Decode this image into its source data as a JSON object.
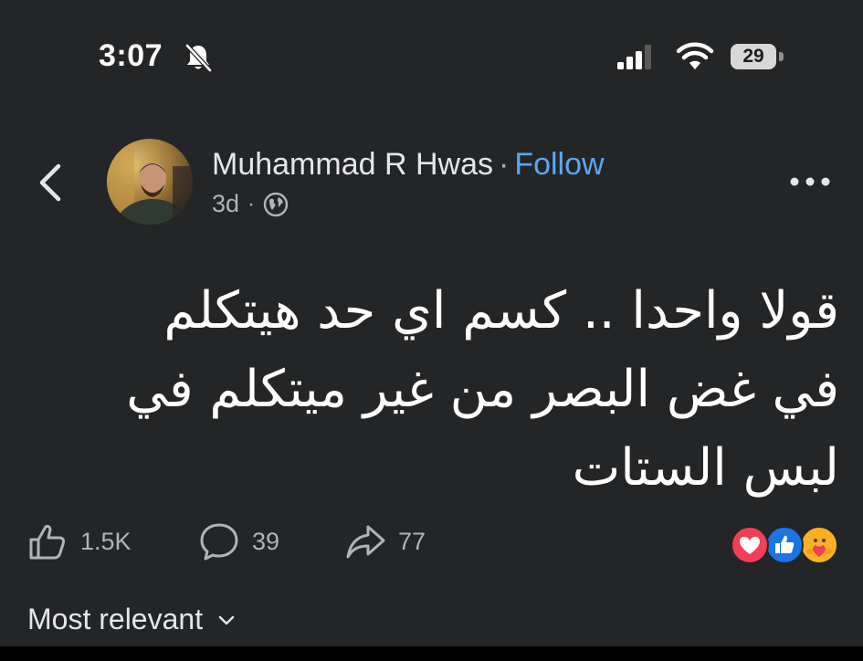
{
  "status_bar": {
    "time": "3:07",
    "battery_level": "29"
  },
  "post": {
    "author": "Muhammad R Hwas",
    "separator": "·",
    "follow_label": "Follow",
    "age": "3d",
    "meta_separator": "·",
    "text_lines": [
      "قولا واحدا .. كسم اي حد هيتكلم",
      "في غض البصر من غير ميتكلم في",
      "لبس الستات"
    ]
  },
  "actions": {
    "likes": "1.5K",
    "comments": "39",
    "shares": "77"
  },
  "reactions": [
    "love",
    "like",
    "care"
  ],
  "comments_section": {
    "sort_label": "Most relevant"
  },
  "icons": {
    "back": "chevron-left-icon",
    "more": "more-dots-icon",
    "audience": "globe-icon",
    "like": "thumbs-up-icon",
    "comment": "speech-bubble-icon",
    "share": "share-arrow-icon",
    "sort": "chevron-down-icon",
    "notifications": "bell-off-icon"
  },
  "colors": {
    "background": "#242526",
    "accent": "#5aa7f5",
    "secondary_text": "#b0b3b8"
  }
}
